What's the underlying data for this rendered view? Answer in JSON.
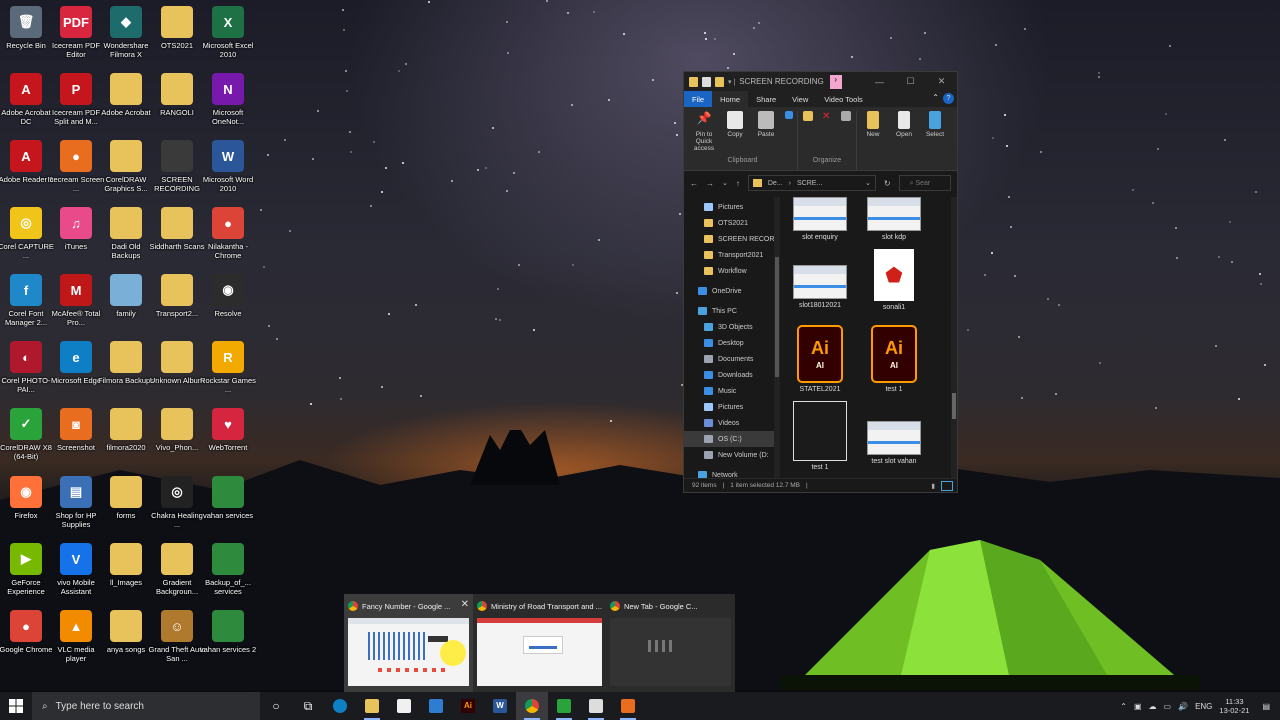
{
  "desktop": {
    "icons": [
      {
        "label": "Recycle Bin",
        "glyph": "🗑",
        "color": "#5a6a7a"
      },
      {
        "label": "Icecream PDF Editor",
        "glyph": "PDF",
        "color": "#d7263d"
      },
      {
        "label": "Wondershare Filmora X",
        "glyph": "◆",
        "color": "#1d6b6b"
      },
      {
        "label": "OTS2021",
        "glyph": "",
        "color": "#e8c25b"
      },
      {
        "label": "Microsoft Excel 2010",
        "glyph": "X",
        "color": "#1e7145"
      },
      {
        "label": "Adobe Acrobat DC",
        "glyph": "A",
        "color": "#c4161c"
      },
      {
        "label": "Icecream PDF Split and M...",
        "glyph": "P",
        "color": "#c4161c"
      },
      {
        "label": "Adobe Acrobat",
        "glyph": "",
        "color": "#e8c25b"
      },
      {
        "label": "RANGOLI",
        "glyph": "",
        "color": "#e8c25b"
      },
      {
        "label": "Microsoft OneNot...",
        "glyph": "N",
        "color": "#7719aa"
      },
      {
        "label": "Adobe Reader 9",
        "glyph": "A",
        "color": "#c4161c"
      },
      {
        "label": "Icecream Screen ...",
        "glyph": "●",
        "color": "#e96d1f"
      },
      {
        "label": "CorelDRAW Graphics S...",
        "glyph": "",
        "color": "#e8c25b"
      },
      {
        "label": "SCREEN RECORDING",
        "glyph": "",
        "color": "#3a3a3a"
      },
      {
        "label": "Microsoft Word 2010",
        "glyph": "W",
        "color": "#2b579a"
      },
      {
        "label": "Corel CAPTURE ...",
        "glyph": "◎",
        "color": "#f0c419"
      },
      {
        "label": "iTunes",
        "glyph": "♫",
        "color": "#e94b8a"
      },
      {
        "label": "Dadi Old Backups",
        "glyph": "",
        "color": "#e8c25b"
      },
      {
        "label": "Siddharth Scans",
        "glyph": "",
        "color": "#e8c25b"
      },
      {
        "label": "Nilakantha - Chrome",
        "glyph": "●",
        "color": "#db4437"
      },
      {
        "label": "Corel Font Manager 2...",
        "glyph": "f",
        "color": "#1e88c8"
      },
      {
        "label": "McAfee® Total Pro...",
        "glyph": "M",
        "color": "#c01818"
      },
      {
        "label": "family",
        "glyph": "",
        "color": "#7ab0d8"
      },
      {
        "label": "Transport2...",
        "glyph": "",
        "color": "#e8c25b"
      },
      {
        "label": "Resolve",
        "glyph": "◉",
        "color": "#2c2c2c"
      },
      {
        "label": "Corel PHOTO-PAI...",
        "glyph": "◐",
        "color": "#b0182e"
      },
      {
        "label": "Microsoft Edge",
        "glyph": "e",
        "color": "#0e7fc4"
      },
      {
        "label": "Filmora Backups",
        "glyph": "",
        "color": "#e8c25b"
      },
      {
        "label": "Unknown Album",
        "glyph": "",
        "color": "#e8c25b"
      },
      {
        "label": "Rockstar Games ...",
        "glyph": "R",
        "color": "#f2a900"
      },
      {
        "label": "CorelDRAW X8 (64-Bit)",
        "glyph": "✓",
        "color": "#2aa33a"
      },
      {
        "label": "Screenshot",
        "glyph": "◙",
        "color": "#e96d1f"
      },
      {
        "label": "filmora2020",
        "glyph": "",
        "color": "#e8c25b"
      },
      {
        "label": "Vivo_Phon...",
        "glyph": "",
        "color": "#e8c25b"
      },
      {
        "label": "WebTorrent",
        "glyph": "♥",
        "color": "#d6263f"
      },
      {
        "label": "Firefox",
        "glyph": "◉",
        "color": "#ff7139"
      },
      {
        "label": "Shop for HP Supplies",
        "glyph": "▤",
        "color": "#3b6fb6"
      },
      {
        "label": "forms",
        "glyph": "",
        "color": "#e8c25b"
      },
      {
        "label": "Chakra Healing ...",
        "glyph": "◎",
        "color": "#222222"
      },
      {
        "label": "vahan services",
        "glyph": "",
        "color": "#2e8b3e"
      },
      {
        "label": "GeForce Experience",
        "glyph": "▶",
        "color": "#76b900"
      },
      {
        "label": "vivo Mobile Assistant",
        "glyph": "V",
        "color": "#1572e8"
      },
      {
        "label": "ll_Images",
        "glyph": "",
        "color": "#e8c25b"
      },
      {
        "label": "Gradient Backgroun...",
        "glyph": "",
        "color": "#e8c25b"
      },
      {
        "label": "Backup_of_... services",
        "glyph": "",
        "color": "#2e8b3e"
      },
      {
        "label": "Google Chrome",
        "glyph": "●",
        "color": "#db4437"
      },
      {
        "label": "VLC media player",
        "glyph": "▲",
        "color": "#f28b00"
      },
      {
        "label": "anya songs",
        "glyph": "",
        "color": "#e8c25b"
      },
      {
        "label": "Grand Theft Auto San ...",
        "glyph": "☺",
        "color": "#b07a2e"
      },
      {
        "label": "vahan services 2",
        "glyph": "",
        "color": "#2e8b3e"
      }
    ]
  },
  "explorer": {
    "title": "SCREEN RECORDING",
    "tabs": [
      "File",
      "Home",
      "Share",
      "View",
      "Video Tools"
    ],
    "ribbon": {
      "clipboard": {
        "name": "Clipboard",
        "items": [
          "Pin to Quick access",
          "Copy",
          "Paste"
        ]
      },
      "organize": {
        "name": "Organize"
      },
      "new_label": "New",
      "open_label": "Open",
      "select_label": "Select"
    },
    "address": {
      "crumb1": "De...",
      "crumb2": "SCRE...",
      "search_placeholder": "Sear"
    },
    "nav": [
      {
        "label": "Pictures",
        "color": "#9cc7ff"
      },
      {
        "label": "OTS2021",
        "color": "#e8c25b"
      },
      {
        "label": "SCREEN RECORD",
        "color": "#e8c25b"
      },
      {
        "label": "Transport2021",
        "color": "#e8c25b"
      },
      {
        "label": "Workflow",
        "color": "#e8c25b"
      },
      {
        "label": "OneDrive",
        "color": "#3a8ee6"
      },
      {
        "label": "This PC",
        "color": "#4aa3df"
      },
      {
        "label": "3D Objects",
        "color": "#4aa3df"
      },
      {
        "label": "Desktop",
        "color": "#3a8ee6"
      },
      {
        "label": "Documents",
        "color": "#9aa4b1"
      },
      {
        "label": "Downloads",
        "color": "#3a8ee6"
      },
      {
        "label": "Music",
        "color": "#3a8ee6"
      },
      {
        "label": "Pictures",
        "color": "#9cc7ff"
      },
      {
        "label": "Videos",
        "color": "#6b8fd6"
      },
      {
        "label": "OS (C:)",
        "color": "#9aa4b1"
      },
      {
        "label": "New Volume (D:",
        "color": "#9aa4b1"
      },
      {
        "label": "Network",
        "color": "#4aa3df"
      }
    ],
    "files": [
      {
        "label": "slot enquiry",
        "kind": "thumb"
      },
      {
        "label": "slot kdp",
        "kind": "thumb"
      },
      {
        "label": "slot18012021",
        "kind": "thumb"
      },
      {
        "label": "sonali1",
        "kind": "pdf"
      },
      {
        "label": "STATEL2021",
        "kind": "ai"
      },
      {
        "label": "test 1",
        "kind": "ai"
      },
      {
        "label": "test 1",
        "kind": "doc"
      },
      {
        "label": "test slot vahan",
        "kind": "thumb"
      }
    ],
    "ai_text": "Ai",
    "ai_sub": "AI",
    "status": {
      "items": "92 items",
      "selected": "1 item selected  12.7 MB"
    }
  },
  "taskbar_thumbs": [
    {
      "title": "Fancy Number - Google ...",
      "close": "✕"
    },
    {
      "title": "Ministry of Road Transport and ..."
    },
    {
      "title": "New Tab - Google C..."
    }
  ],
  "taskbar": {
    "search_placeholder": "Type here to search",
    "apps": [
      {
        "name": "cortana-icon",
        "color": "#ffffff",
        "glyph": "○"
      },
      {
        "name": "task-view-icon",
        "color": "#ffffff",
        "glyph": "⧉"
      },
      {
        "name": "edge-icon",
        "color": "#0e7fc4",
        "glyph": ""
      },
      {
        "name": "file-explorer-icon",
        "color": "#e8c25b",
        "glyph": ""
      },
      {
        "name": "store-icon",
        "color": "#f0f0f0",
        "glyph": ""
      },
      {
        "name": "mail-icon",
        "color": "#2f7dd1",
        "glyph": ""
      },
      {
        "name": "illustrator-icon",
        "color": "#330000",
        "glyph": "Ai"
      },
      {
        "name": "word-icon",
        "color": "#2b579a",
        "glyph": "W"
      },
      {
        "name": "chrome-icon",
        "color": "#db4437",
        "glyph": ""
      },
      {
        "name": "coreldraw-icon",
        "color": "#2aa33a",
        "glyph": ""
      },
      {
        "name": "paint-icon",
        "color": "#dddddd",
        "glyph": ""
      },
      {
        "name": "icecream-icon",
        "color": "#e96d1f",
        "glyph": ""
      }
    ],
    "tray_lang": "ENG",
    "time": "11:33",
    "date": "13-02-21"
  }
}
